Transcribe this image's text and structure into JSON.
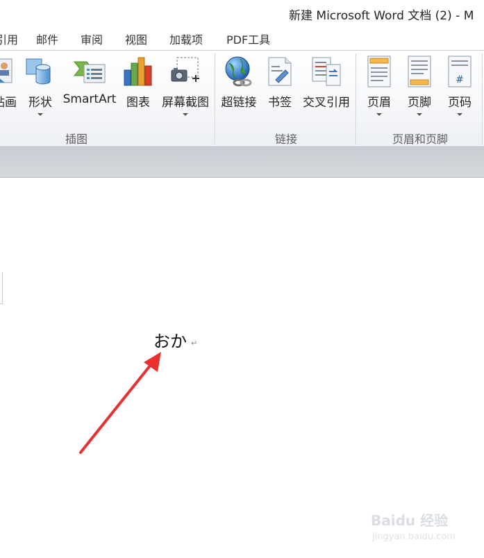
{
  "window": {
    "title": "新建 Microsoft Word 文档 (2)  -  M"
  },
  "menu": {
    "items": [
      {
        "label": "引用"
      },
      {
        "label": "邮件"
      },
      {
        "label": "审阅"
      },
      {
        "label": "视图"
      },
      {
        "label": "加载项"
      },
      {
        "label": "PDF工具"
      }
    ]
  },
  "ribbon": {
    "groups": {
      "illustrations": {
        "label": "插图",
        "buttons": [
          {
            "label": "贴画",
            "icon": "clip-art-icon"
          },
          {
            "label": "形状",
            "icon": "shapes-icon"
          },
          {
            "label": "SmartArt",
            "icon": "smartart-icon"
          },
          {
            "label": "图表",
            "icon": "chart-icon"
          },
          {
            "label": "屏幕截图",
            "icon": "screenshot-icon"
          }
        ]
      },
      "links": {
        "label": "链接",
        "buttons": [
          {
            "label": "超链接",
            "icon": "hyperlink-icon"
          },
          {
            "label": "书签",
            "icon": "bookmark-icon"
          },
          {
            "label": "交叉引用",
            "icon": "cross-reference-icon"
          }
        ]
      },
      "header_footer": {
        "label": "页眉和页脚",
        "buttons": [
          {
            "label": "页眉",
            "icon": "header-icon"
          },
          {
            "label": "页脚",
            "icon": "footer-icon"
          },
          {
            "label": "页码",
            "icon": "page-number-icon"
          }
        ]
      }
    }
  },
  "document": {
    "text": "おか",
    "paragraph_mark": "↵"
  },
  "annotation": {
    "arrow_color": "#e8312f"
  },
  "watermark": {
    "text": "Baidu 经验",
    "url": "jingyan.baidu.com"
  }
}
